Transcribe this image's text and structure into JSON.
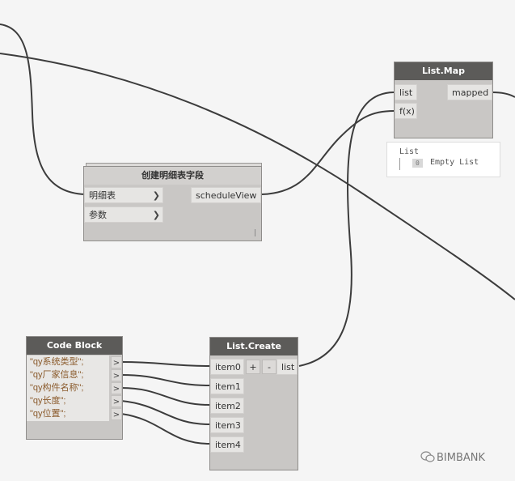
{
  "colors": {
    "canvas": "#f5f5f5",
    "node_header": "#5c5b59",
    "node_body": "#c9c7c5",
    "wire": "#3c3c3c",
    "code_text": "#8a5a2b"
  },
  "list_map": {
    "title": "List.Map",
    "inputs": [
      "list",
      "f(x)"
    ],
    "output": "mapped",
    "preview": {
      "header": "List",
      "badge": "0",
      "text": "Empty List"
    }
  },
  "schedule_node": {
    "title": "创建明细表字段",
    "inputs": [
      "明细表",
      "参数"
    ],
    "output": "scheduleView",
    "footer": "|"
  },
  "code_block": {
    "title": "Code Block",
    "lines": [
      "\"qy系统类型\";",
      "\"qy厂家信息\";",
      "\"qy构件名称\";",
      "\"qy长度\";",
      "\"qy位置\";"
    ],
    "out_glyph": ">"
  },
  "list_create": {
    "title": "List.Create",
    "inputs": [
      "item0",
      "item1",
      "item2",
      "item3",
      "item4"
    ],
    "add_label": "+",
    "remove_label": "-",
    "output": "list"
  },
  "watermark": {
    "icon": "wechat-icon",
    "text": "BIMBANK"
  }
}
